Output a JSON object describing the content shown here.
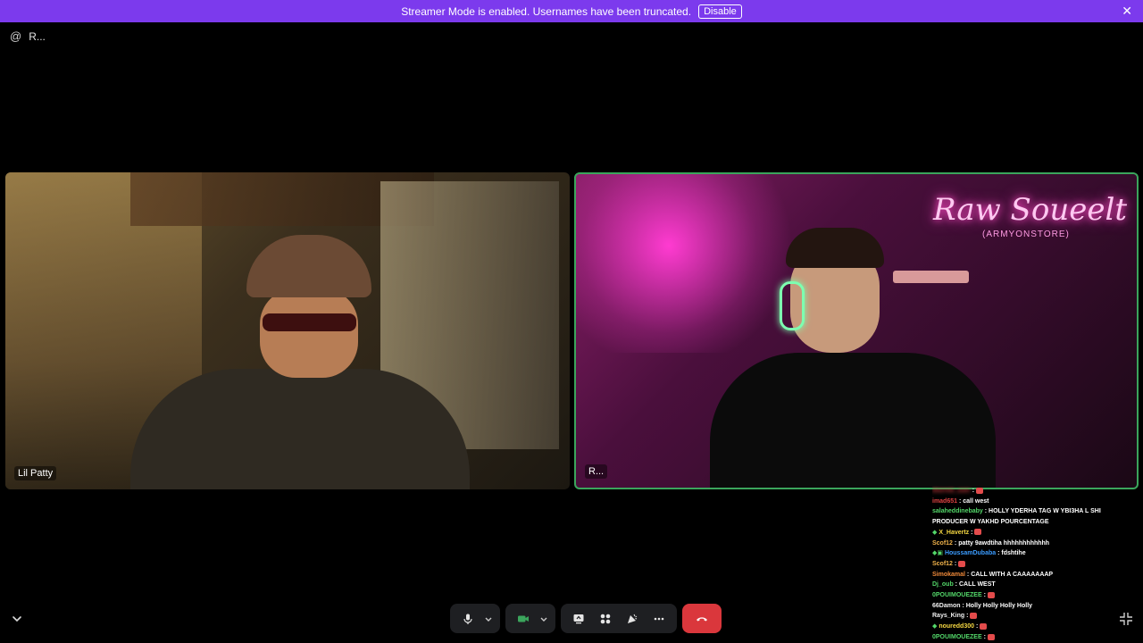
{
  "banner": {
    "text": "Streamer Mode is enabled. Usernames have been truncated.",
    "button_label": "Disable",
    "close_glyph": "✕"
  },
  "channel": {
    "at_symbol": "@",
    "name": "R..."
  },
  "tiles": [
    {
      "name": "Lil Patty"
    },
    {
      "name": "R...",
      "speaking": true
    }
  ],
  "scene": {
    "neon_sign": "Raw Soueelt",
    "neon_sub": "(ARMYONSTORE)"
  },
  "chat": [
    {
      "user": "blurred_user",
      "msg": "",
      "emote": true,
      "color": "#e04343"
    },
    {
      "user": "imad651",
      "msg": "call west",
      "color": "#e04343"
    },
    {
      "user": "salaheddinebaby",
      "msg": "HOLLY YDERHA TAG W YBI3HA L SHI PRODUCER W YAKHD POURCENTAGE",
      "color": "#53d769",
      "wrap": true
    },
    {
      "user": "X_Havertz",
      "msg": "",
      "emote": true,
      "color": "#f5d742",
      "badge": "◆"
    },
    {
      "user": "Scof12",
      "msg": "patty 9awdtiha hhhhhhhhhhhh",
      "color": "#f0b24a"
    },
    {
      "user": "HoussamDubaba",
      "msg": "fdshtihe",
      "color": "#3b9cff",
      "badge": "◆▣"
    },
    {
      "user": "Scof12",
      "msg": "",
      "emote": true,
      "color": "#f0b24a"
    },
    {
      "user": "Simokamal",
      "msg": "CALL WITH A CAAAAAAAP",
      "color": "#f08a3a"
    },
    {
      "user": "Dj_oub",
      "msg": "CALL WEST",
      "color": "#53d769"
    },
    {
      "user": "0POUIMOUEZEE",
      "msg": "",
      "emote": true,
      "color": "#53d769"
    },
    {
      "user": "66Damon",
      "msg": "Holly Holly Holly Holly",
      "color": "#f0f0f0"
    },
    {
      "user": "Rays_King",
      "msg": "",
      "emote": true,
      "color": "#f0f0f0"
    },
    {
      "user": "nouredd300",
      "msg": "",
      "emote": true,
      "color": "#f5d742",
      "badge": "◆"
    },
    {
      "user": "0POUIMOUEZEE",
      "msg": "",
      "emote": true,
      "color": "#53d769"
    }
  ],
  "controls": {
    "mic": "microphone-icon",
    "camera": "camera-icon",
    "share": "screen-share-icon",
    "activities": "activities-icon",
    "soundboard": "soundboard-icon",
    "more": "more-icon",
    "leave": "hang-up-icon"
  },
  "colors": {
    "banner": "#7c3aed",
    "speaking_border": "#3ba55c",
    "leave": "#da373c",
    "camera_on": "#3ba55c"
  }
}
